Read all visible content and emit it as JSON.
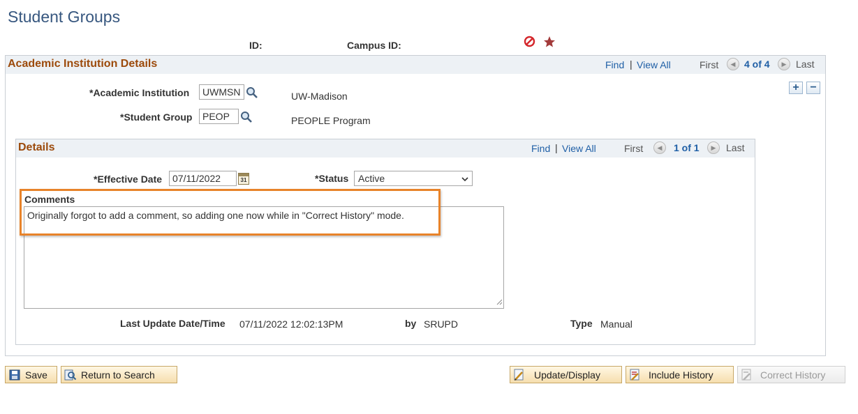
{
  "page": {
    "title": "Student Groups",
    "id_label": "ID:",
    "campus_id_label": "Campus ID:"
  },
  "academic_section": {
    "title": "Academic Institution Details",
    "find": "Find",
    "view_all": "View All",
    "sep": "|",
    "first": "First",
    "page_info": "4 of 4",
    "last": "Last",
    "add_row": "+",
    "delete_row": "−",
    "institution_label": "*Academic Institution",
    "institution_value": "UWMSN",
    "institution_desc": "UW-Madison",
    "group_label": "*Student Group",
    "group_value": "PEOP",
    "group_desc": "PEOPLE Program"
  },
  "details_section": {
    "title": "Details",
    "find": "Find",
    "view_all": "View All",
    "sep": "|",
    "first": "First",
    "page_info": "1 of 1",
    "last": "Last",
    "effective_date_label": "*Effective Date",
    "effective_date_value": "07/11/2022",
    "calendar_glyph": "31",
    "status_label": "*Status",
    "status_value": "Active",
    "comments_label": "Comments",
    "comments_value": "Originally forgot to add a comment, so adding one now while in \"Correct History\" mode.",
    "last_update_label": "Last Update Date/Time",
    "last_update_value": "07/11/2022 12:02:13PM",
    "by_label": "by",
    "by_value": "SRUPD",
    "type_label": "Type",
    "type_value": "Manual"
  },
  "toolbar": {
    "save": "Save",
    "return_to_search": "Return to Search",
    "update_display": "Update/Display",
    "include_history": "Include History",
    "correct_history": "Correct History"
  },
  "colors": {
    "highlight_box": "#e8832a",
    "section_title": "#9c4a0b",
    "link": "#1f5fa6"
  }
}
